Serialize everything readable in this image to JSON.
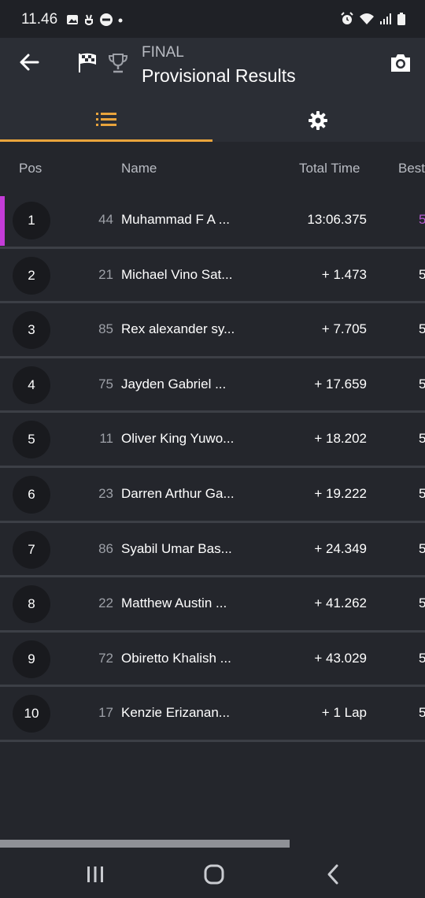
{
  "status_bar": {
    "time": "11.46",
    "left_icons": [
      "image-icon",
      "peace-hand-icon",
      "minus-circle-icon",
      "dot-icon"
    ],
    "right_icons": [
      "alarm-icon",
      "wifi-icon",
      "signal-icon",
      "battery-icon"
    ]
  },
  "header": {
    "subtitle": "FINAL",
    "title": "Provisional Results",
    "icons": [
      "back-arrow-icon",
      "checkered-flag-icon",
      "trophy-icon",
      "camera-icon"
    ]
  },
  "tabs": [
    {
      "icon": "list-icon",
      "active": true
    },
    {
      "icon": "gear-icon",
      "active": false
    }
  ],
  "colors": {
    "accent": "#e9a43c",
    "leader_marker": "#c43cd8",
    "best_lap_highlight": "#b55ad0",
    "background": "#24262c"
  },
  "table": {
    "columns": {
      "pos": "Pos",
      "name": "Name",
      "total_time": "Total Time",
      "best": "Best"
    },
    "rows": [
      {
        "pos": "1",
        "number": "44",
        "name": "Muhammad F A ...",
        "total": "13:06.375",
        "best": "5"
      },
      {
        "pos": "2",
        "number": "21",
        "name": "Michael Vino Sat...",
        "total": "+ 1.473",
        "best": "5"
      },
      {
        "pos": "3",
        "number": "85",
        "name": "Rex alexander sy...",
        "total": "+ 7.705",
        "best": "5"
      },
      {
        "pos": "4",
        "number": "75",
        "name": "Jayden Gabriel ...",
        "total": "+ 17.659",
        "best": "5"
      },
      {
        "pos": "5",
        "number": "11",
        "name": "Oliver King Yuwo...",
        "total": "+ 18.202",
        "best": "5"
      },
      {
        "pos": "6",
        "number": "23",
        "name": "Darren Arthur Ga...",
        "total": "+ 19.222",
        "best": "5"
      },
      {
        "pos": "7",
        "number": "86",
        "name": "Syabil Umar Bas...",
        "total": "+ 24.349",
        "best": "5"
      },
      {
        "pos": "8",
        "number": "22",
        "name": "Matthew Austin ...",
        "total": "+ 41.262",
        "best": "5"
      },
      {
        "pos": "9",
        "number": "72",
        "name": "Obiretto Khalish ...",
        "total": "+ 43.029",
        "best": "5"
      },
      {
        "pos": "10",
        "number": "17",
        "name": "Kenzie Erizanan...",
        "total": "+ 1 Lap",
        "best": "5"
      }
    ]
  },
  "navbar": {
    "icons": [
      "recent-apps-icon",
      "home-icon",
      "back-icon"
    ]
  }
}
